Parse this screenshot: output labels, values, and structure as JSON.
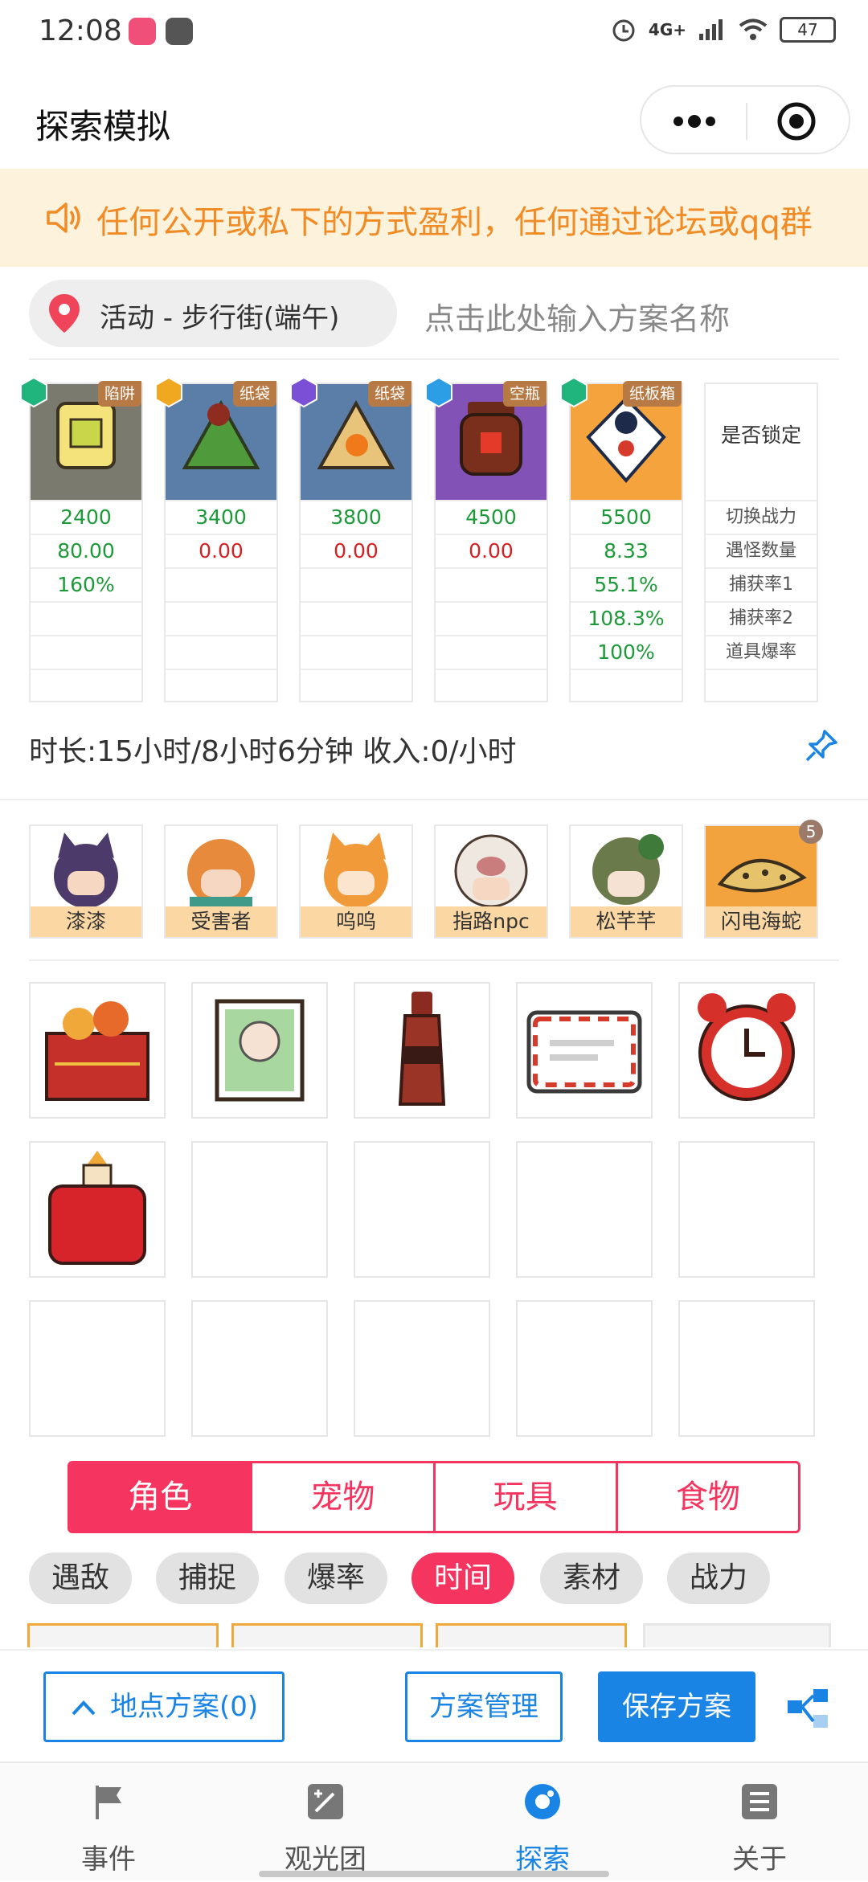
{
  "status_bar": {
    "time": "12:08",
    "network": "4G+",
    "battery": "47"
  },
  "nav": {
    "title": "探索模拟"
  },
  "notice": {
    "text": "任何公开或私下的方式盈利，任何通过论坛或qq群"
  },
  "location": {
    "label": "活动 - 步行街(端午)",
    "plan_placeholder": "点击此处输入方案名称"
  },
  "cards": [
    {
      "tag": "陷阱",
      "power": "2400",
      "row2": "80.00",
      "row3": "160%",
      "row4": "",
      "row5": "",
      "elem_color": "#1fb57c"
    },
    {
      "tag": "纸袋",
      "power": "3400",
      "row2": "0.00",
      "row3": "",
      "row4": "",
      "row5": "",
      "elem_color": "#f0a821"
    },
    {
      "tag": "纸袋",
      "power": "3800",
      "row2": "0.00",
      "row3": "",
      "row4": "",
      "row5": "",
      "elem_color": "#7b4fd6"
    },
    {
      "tag": "空瓶",
      "power": "4500",
      "row2": "0.00",
      "row3": "",
      "row4": "",
      "row5": "",
      "elem_color": "#2b9ee6"
    },
    {
      "tag": "纸板箱",
      "power": "5500",
      "row2": "8.33",
      "row3": "55.1%",
      "row4": "108.3%",
      "row5": "100%",
      "elem_color": "#1fb57c"
    }
  ],
  "lock_card": {
    "title": "是否锁定",
    "rows": [
      "切换战力",
      "遇怪数量",
      "捕获率1",
      "捕获率2",
      "道具爆率"
    ]
  },
  "summary": {
    "text": "时长:15小时/8小时6分钟 收入:0/小时"
  },
  "characters": [
    {
      "name": "漆漆",
      "color": "#4b3a6a"
    },
    {
      "name": "受害者",
      "color": "#e88a3c"
    },
    {
      "name": "呜呜",
      "color": "#f09a3a"
    },
    {
      "name": "指路npc",
      "color": "#e9e1d8"
    },
    {
      "name": "松芊芊",
      "color": "#6b7a4a"
    },
    {
      "name": "闪电海蛇",
      "color": "#f3a33d",
      "badge": "5"
    }
  ],
  "tabs": [
    "角色",
    "宠物",
    "玩具",
    "食物"
  ],
  "active_tab": "角色",
  "filters": [
    "遇敌",
    "捕捉",
    "爆率",
    "时间",
    "素材",
    "战力"
  ],
  "active_filter": "时间",
  "actions": {
    "location_plans": "地点方案(0)",
    "plan_manage": "方案管理",
    "save_plan": "保存方案"
  },
  "bottom_nav": [
    {
      "label": "事件",
      "icon": "flag-icon"
    },
    {
      "label": "观光团",
      "icon": "edit-square-icon"
    },
    {
      "label": "探索",
      "icon": "explore-icon"
    },
    {
      "label": "关于",
      "icon": "list-icon"
    }
  ],
  "active_nav": "探索",
  "colors": {
    "accent_pink": "#f5355f",
    "accent_blue": "#1a84e5",
    "notice_bg": "#fdf3dc",
    "notice_text": "#f08b26",
    "value_green": "#1c9a38",
    "value_red": "#d42020"
  }
}
